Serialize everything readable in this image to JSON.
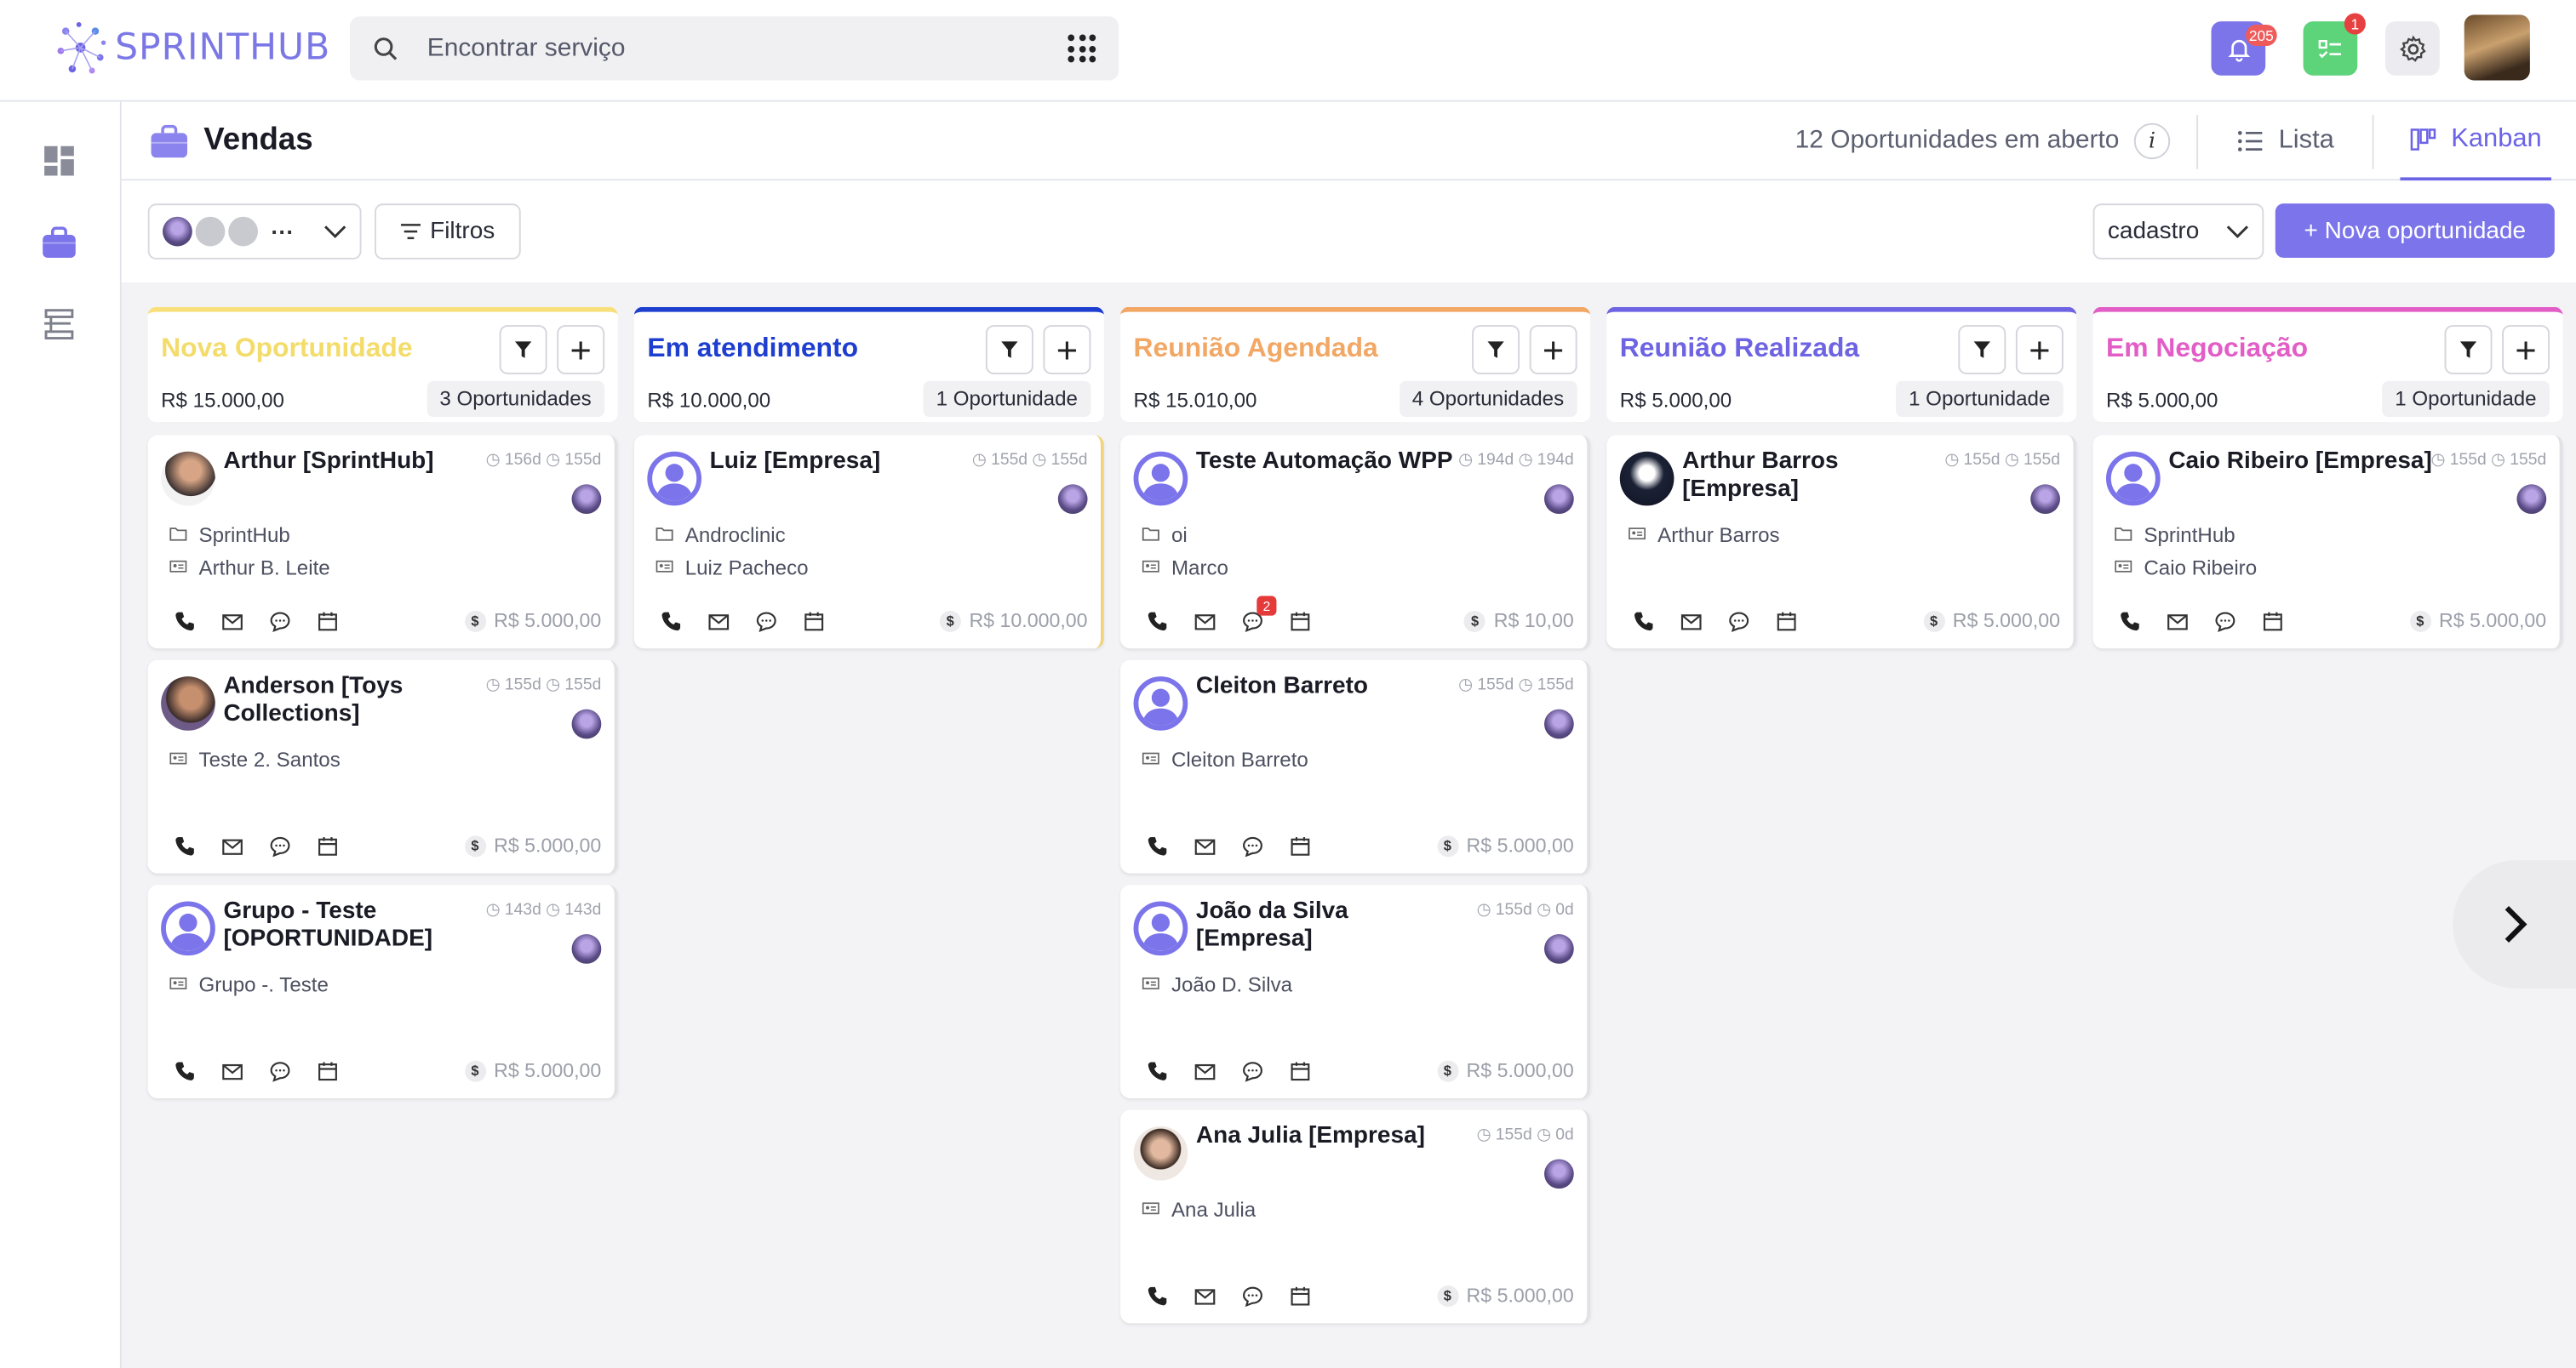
{
  "app": {
    "logo_text": "SPRINTHUB",
    "search_placeholder": "Encontrar serviço",
    "notifications_count": "205",
    "tasks_count": "1"
  },
  "page": {
    "title": "Vendas",
    "open_count_label": "12 Oportunidades em aberto",
    "info_label": "i",
    "views": [
      {
        "label": "Lista",
        "active": false
      },
      {
        "label": "Kanban",
        "active": true
      }
    ]
  },
  "toolbar": {
    "users_more": "···",
    "filters_label": "Filtros",
    "sort_select_value": "cadastro",
    "new_button_label": "+ Nova oportunidade"
  },
  "colors": {
    "accent": "#7b74ea",
    "stage_nova": "#f7e07a",
    "stage_atendimento": "#1d3ecf",
    "stage_reuniao_agendada": "#f2a765",
    "stage_reuniao_realizada": "#6d63e3",
    "stage_negociacao": "#e25dc6"
  },
  "columns": [
    {
      "title": "Nova Oportunidade",
      "total": "R$ 15.000,00",
      "count": "3 Oportunidades",
      "cards": [
        {
          "name": "Arthur [SprintHub]",
          "time": "◷ 156d ◷ 155d",
          "company": "SprintHub",
          "contact": "Arthur B. Leite",
          "value": "R$ 5.000,00",
          "avatar": "photo-man"
        },
        {
          "name": "Anderson [Toys Collections]",
          "time": "◷ 155d ◷ 155d",
          "company": "",
          "contact": "Teste 2. Santos",
          "value": "R$ 5.000,00",
          "avatar": "photo-man2"
        },
        {
          "name": "Grupo - Teste [OPORTUNIDADE]",
          "time": "◷ 143d ◷ 143d",
          "company": "",
          "contact": "Grupo -. Teste",
          "value": "R$ 5.000,00",
          "avatar": "default"
        }
      ]
    },
    {
      "title": "Em atendimento",
      "total": "R$ 10.000,00",
      "count": "1 Oportunidade",
      "cards": [
        {
          "name": "Luiz [Empresa]",
          "time": "◷ 155d ◷ 155d",
          "company": "Androclinic",
          "contact": "Luiz Pacheco",
          "value": "R$ 10.000,00",
          "avatar": "default"
        }
      ]
    },
    {
      "title": "Reunião Agendada",
      "total": "R$ 15.010,00",
      "count": "4 Oportunidades",
      "cards": [
        {
          "name": "Teste Automação WPP",
          "time": "◷ 194d ◷ 194d",
          "company": "oi",
          "contact": "Marco",
          "value": "R$ 10,00",
          "avatar": "default",
          "chat_badge": "2"
        },
        {
          "name": "Cleiton Barreto",
          "time": "◷ 155d ◷ 155d",
          "company": "",
          "contact": "Cleiton Barreto",
          "value": "R$ 5.000,00",
          "avatar": "default"
        },
        {
          "name": "João da Silva [Empresa]",
          "time": "◷ 155d ◷ 0d",
          "company": "",
          "contact": "João D. Silva",
          "value": "R$ 5.000,00",
          "avatar": "default"
        },
        {
          "name": "Ana Julia [Empresa]",
          "time": "◷ 155d ◷ 0d",
          "company": "",
          "contact": "Ana Julia",
          "value": "R$ 5.000,00",
          "avatar": "photo-woman"
        }
      ]
    },
    {
      "title": "Reunião Realizada",
      "total": "R$ 5.000,00",
      "count": "1 Oportunidade",
      "cards": [
        {
          "name": "Arthur Barros [Empresa]",
          "time": "◷ 155d ◷ 155d",
          "company": "",
          "contact": "Arthur Barros",
          "value": "R$ 5.000,00",
          "avatar": "photo-dark"
        }
      ]
    },
    {
      "title": "Em Negociação",
      "total": "R$ 5.000,00",
      "count": "1 Oportunidade",
      "cards": [
        {
          "name": "Caio Ribeiro [Empresa]",
          "time": "◷ 155d ◷ 155d",
          "company": "SprintHub",
          "contact": "Caio Ribeiro",
          "value": "R$ 5.000,00",
          "avatar": "default"
        }
      ]
    }
  ],
  "icons": {
    "search": "search-icon",
    "apps": "grid-dots-icon",
    "bell": "bell-icon",
    "tasks": "checklist-icon",
    "settings": "gear-icon",
    "dashboard": "dashboard-icon",
    "sales": "briefcase-icon",
    "pipeline": "route-icon",
    "filter": "filter-icon",
    "add": "plus-icon",
    "phone": "phone-icon",
    "email": "mail-icon",
    "chat": "chat-icon",
    "calendar": "calendar-icon",
    "next": "chevron-right-icon"
  }
}
